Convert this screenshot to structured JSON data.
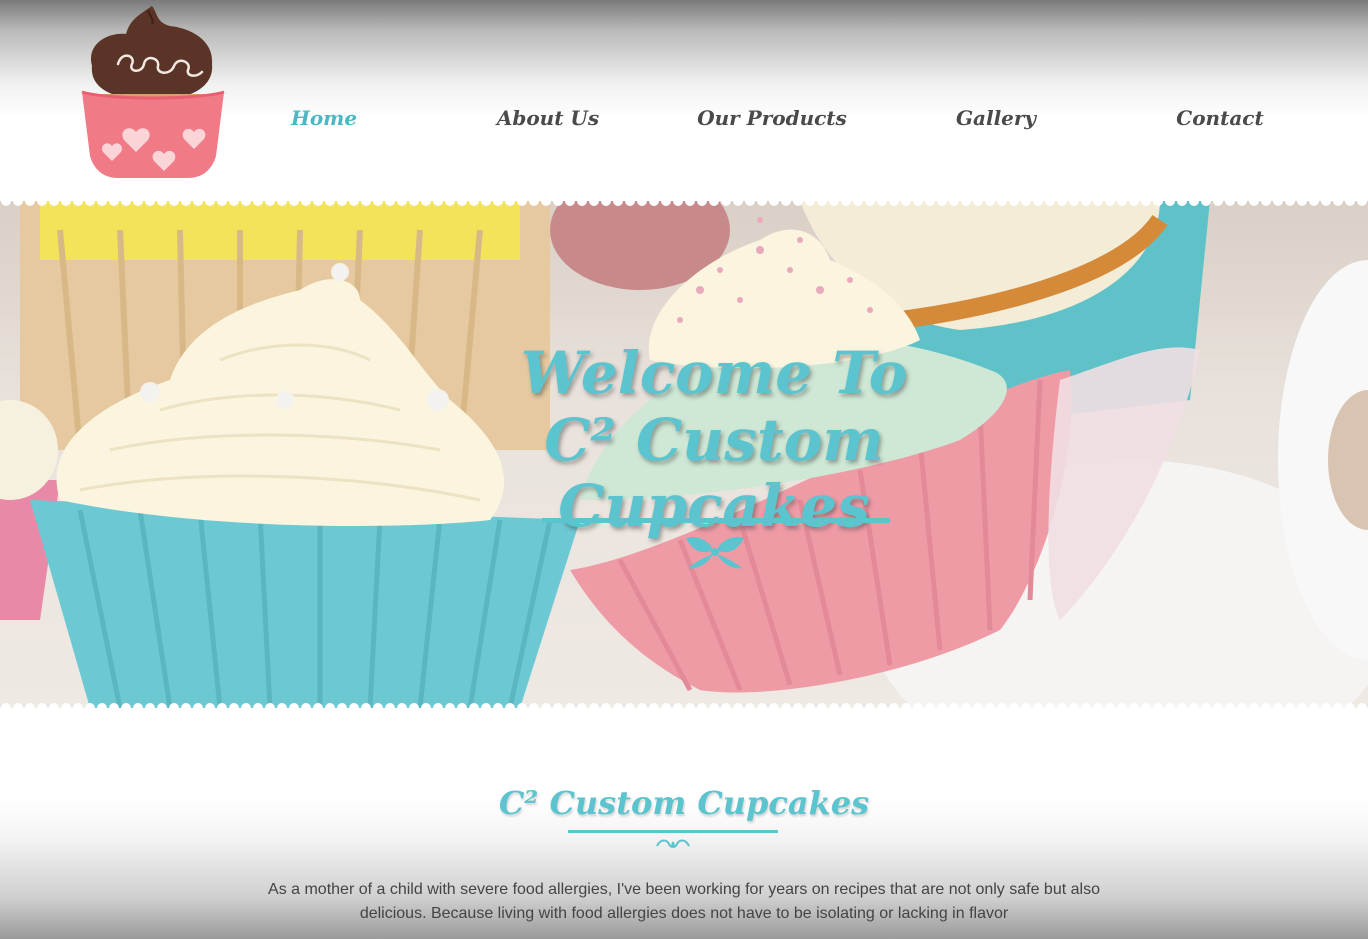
{
  "brand": {
    "logo_icon": "cupcake-logo-icon",
    "colors": {
      "accent": "#5cc4cf",
      "nav_text": "#4a4a4a",
      "liner_pink": "#f07a86",
      "frosting_brown": "#5a3426"
    }
  },
  "nav": {
    "items": [
      {
        "label": "Home",
        "active": true
      },
      {
        "label": "About Us",
        "active": false
      },
      {
        "label": "Our Products",
        "active": false
      },
      {
        "label": "Gallery",
        "active": false
      },
      {
        "label": "Contact",
        "active": false
      }
    ]
  },
  "hero": {
    "line1": "Welcome To",
    "line2": "C² Custom Cupcakes",
    "ornament_icon": "bow-ornament-icon"
  },
  "about": {
    "title": "C² Custom Cupcakes",
    "ornament_icon": "swirl-ornament-icon",
    "text": "As a mother of a child with severe food allergies, I've been working for years on recipes that are not only safe but also delicious. Because living with food allergies does not have to be isolating or lacking in flavor"
  }
}
